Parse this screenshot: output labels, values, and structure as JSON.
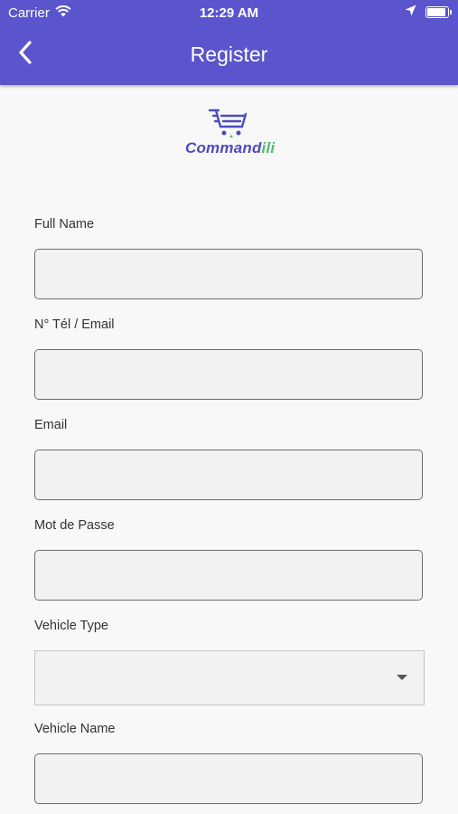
{
  "status_bar": {
    "carrier": "Carrier",
    "time": "12:29 AM"
  },
  "nav": {
    "title": "Register"
  },
  "logo": {
    "name_part1": "Comman",
    "name_part2": "d",
    "name_part3": "ili"
  },
  "form": {
    "full_name_label": "Full Name",
    "full_name_value": "",
    "phone_email_label": "N° Tél / Email",
    "phone_email_value": "",
    "email_label": "Email",
    "email_value": "",
    "password_label": "Mot de Passe",
    "password_value": "",
    "vehicle_type_label": "Vehicle Type",
    "vehicle_type_value": "",
    "vehicle_name_label": "Vehicle Name",
    "vehicle_name_value": ""
  },
  "colors": {
    "header": "#5a55cc",
    "logo_primary": "#4e4bbf",
    "logo_accent": "#56b96b"
  }
}
